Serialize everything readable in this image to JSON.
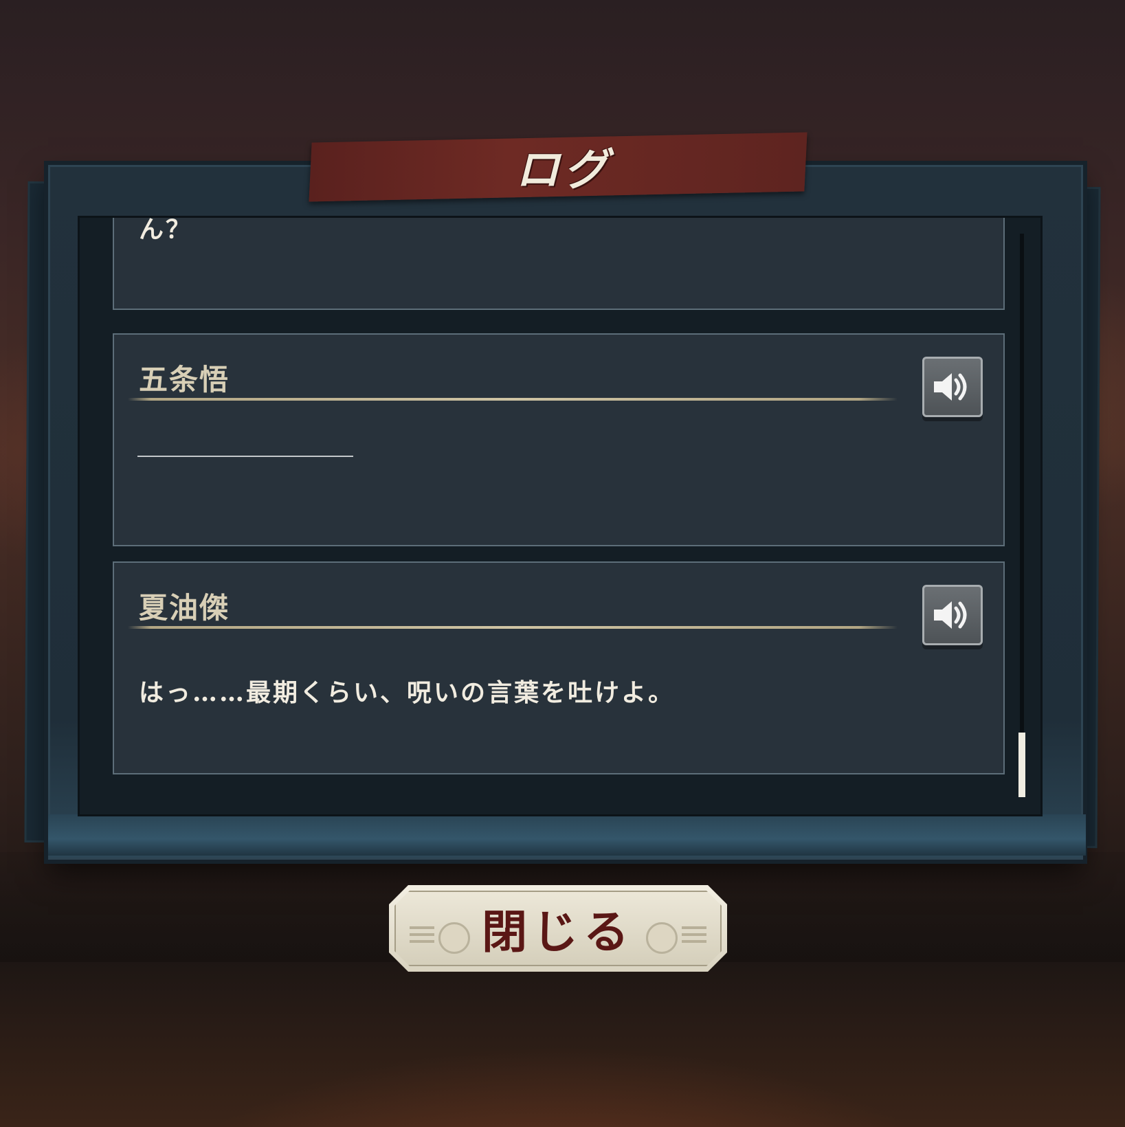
{
  "title": "ログ",
  "log_entries": [
    {
      "speaker": "",
      "text": "ん？",
      "has_voice": false
    },
    {
      "speaker": "五条悟",
      "text": "",
      "has_voice": true
    },
    {
      "speaker": "夏油傑",
      "text": "はっ……最期くらい、呪いの言葉を吐けよ。",
      "has_voice": true
    }
  ],
  "close_button": {
    "label": "閉じる"
  },
  "scroll": {
    "position": 1.0
  },
  "icons": {
    "voice": "speaker-icon"
  },
  "colors": {
    "accent_red": "#5a211e",
    "panel": "#28323b",
    "speaker_name": "#d8cfb6",
    "close_label": "#5a1715"
  }
}
